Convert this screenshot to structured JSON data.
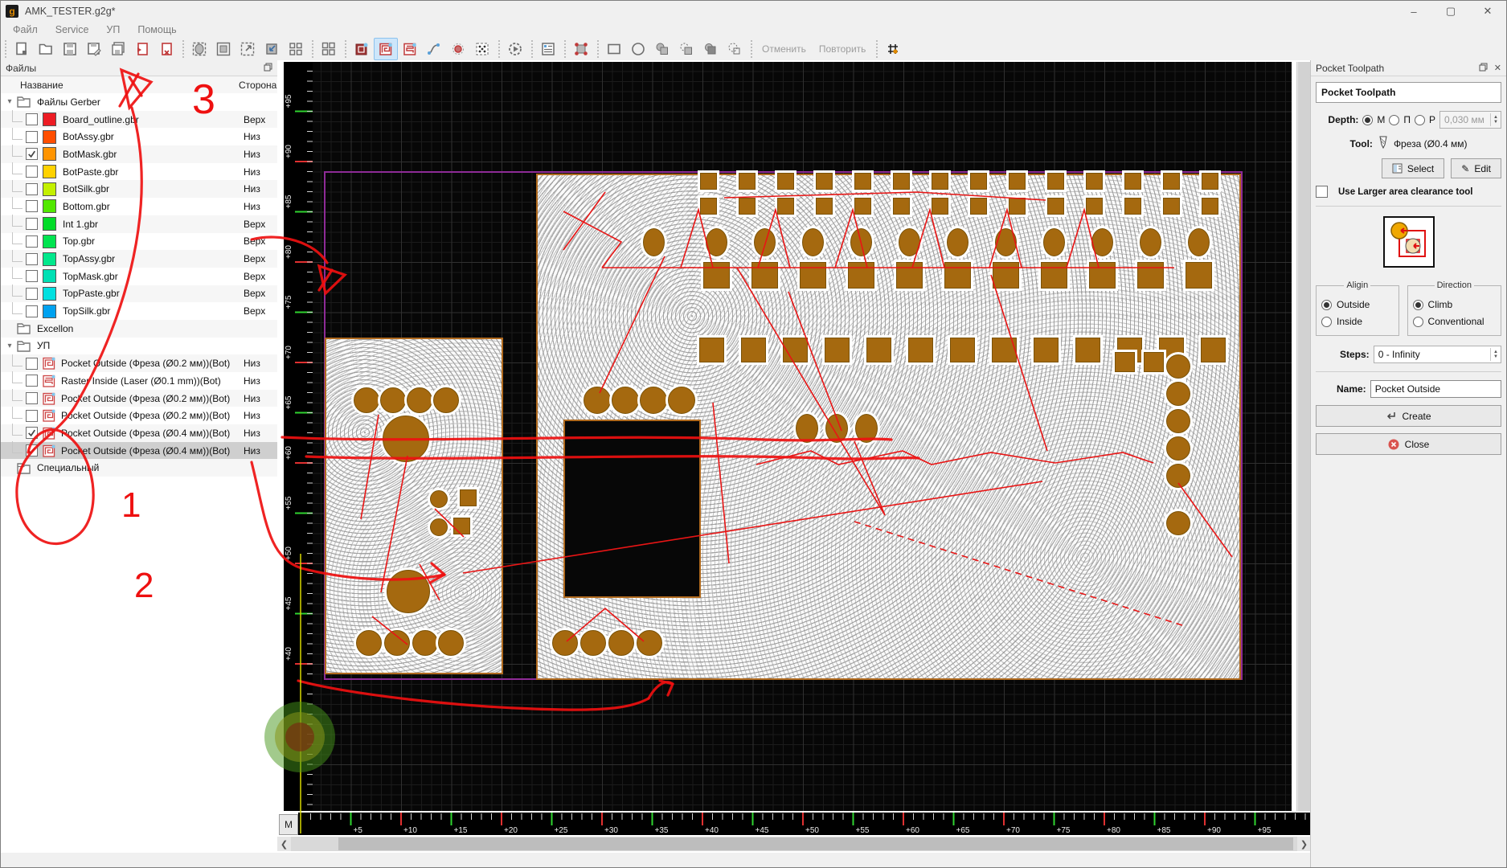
{
  "window": {
    "title": "AMK_TESTER.g2g*"
  },
  "menu": {
    "items": [
      "Файл",
      "Service",
      "УП",
      "Помощь"
    ]
  },
  "toolbar": {
    "undo": "Отменить",
    "redo": "Повторить",
    "groups": [
      [
        {
          "name": "new-file-button",
          "icon": "new"
        },
        {
          "name": "open-button",
          "icon": "open"
        },
        {
          "name": "save-button",
          "icon": "save"
        },
        {
          "name": "save-as-button",
          "icon": "saveAs"
        },
        {
          "name": "save-all-button",
          "icon": "saveAll"
        },
        {
          "name": "import-job-button",
          "icon": "docRedArrow"
        },
        {
          "name": "delete-job-button",
          "icon": "docRedX"
        }
      ],
      [
        {
          "name": "fit-selection-button",
          "icon": "fitSel"
        },
        {
          "name": "fill-view-button",
          "icon": "fillSq"
        },
        {
          "name": "zoom-extents-button",
          "icon": "expand"
        },
        {
          "name": "zoom-selection-button",
          "icon": "shrink"
        },
        {
          "name": "panelize-button",
          "icon": "gridSm"
        }
      ],
      [
        {
          "name": "array-copy-button",
          "icon": "gridBig"
        }
      ],
      [
        {
          "name": "show-board-button",
          "icon": "pocketDoc"
        },
        {
          "name": "show-toolpath-button",
          "icon": "pocketSpiral",
          "active": true
        },
        {
          "name": "show-raster-button",
          "icon": "rasterLines"
        },
        {
          "name": "show-curves-button",
          "icon": "curve"
        },
        {
          "name": "show-drills-button",
          "icon": "circleRed"
        },
        {
          "name": "show-points-button",
          "icon": "dotsSq"
        }
      ],
      [
        {
          "name": "simulate-button",
          "icon": "gearPlay"
        }
      ],
      [
        {
          "name": "properties-button",
          "icon": "form"
        }
      ],
      [
        {
          "name": "transform-button",
          "icon": "transformRed"
        }
      ],
      [
        {
          "name": "draw-rect-button",
          "icon": "rect"
        },
        {
          "name": "draw-circle-button",
          "icon": "circle"
        },
        {
          "name": "bool-union-button",
          "icon": "boolUnion"
        },
        {
          "name": "bool-subtract-button",
          "icon": "boolSub"
        },
        {
          "name": "bool-intersect-button",
          "icon": "boolInt"
        },
        {
          "name": "bool-outline-button",
          "icon": "boolDot"
        }
      ],
      [
        {
          "name": "undo-button",
          "label": "Отменить",
          "disabled": true
        },
        {
          "name": "redo-button",
          "label": "Повторить",
          "disabled": true
        }
      ],
      [
        {
          "name": "snap-grid-button",
          "icon": "snapGrid"
        }
      ]
    ]
  },
  "files_panel": {
    "title": "Файлы",
    "name_col": "Название",
    "side_col": "Сторона",
    "rows": [
      {
        "kind": "folder",
        "label": "Файлы Gerber",
        "expanded": true
      },
      {
        "kind": "gerber",
        "label": "Board_outline.gbr",
        "color": "#ed1c24",
        "side": "Верх",
        "checked": false
      },
      {
        "kind": "gerber",
        "label": "BotAssy.gbr",
        "color": "#ff4e00",
        "side": "Низ",
        "checked": false
      },
      {
        "kind": "gerber",
        "label": "BotMask.gbr",
        "color": "#ff9400",
        "side": "Низ",
        "checked": true
      },
      {
        "kind": "gerber",
        "label": "BotPaste.gbr",
        "color": "#ffd200",
        "side": "Низ",
        "checked": false
      },
      {
        "kind": "gerber",
        "label": "BotSilk.gbr",
        "color": "#c3f000",
        "side": "Низ",
        "checked": false
      },
      {
        "kind": "gerber",
        "label": "Bottom.gbr",
        "color": "#52e800",
        "side": "Низ",
        "checked": false
      },
      {
        "kind": "gerber",
        "label": "Int 1.gbr",
        "color": "#00dc28",
        "side": "Верх",
        "checked": false
      },
      {
        "kind": "gerber",
        "label": "Top.gbr",
        "color": "#00e450",
        "side": "Верх",
        "checked": false
      },
      {
        "kind": "gerber",
        "label": "TopAssy.gbr",
        "color": "#00e88c",
        "side": "Верх",
        "checked": false
      },
      {
        "kind": "gerber",
        "label": "TopMask.gbr",
        "color": "#00e0b4",
        "side": "Верх",
        "checked": false
      },
      {
        "kind": "gerber",
        "label": "TopPaste.gbr",
        "color": "#00e0e0",
        "side": "Верх",
        "checked": false
      },
      {
        "kind": "gerber",
        "label": "TopSilk.gbr",
        "color": "#00a2f0",
        "side": "Верх",
        "checked": false
      },
      {
        "kind": "folder",
        "label": "Excellon",
        "expanded": false
      },
      {
        "kind": "folder",
        "label": "УП",
        "expanded": true
      },
      {
        "kind": "job",
        "icon": "pocket",
        "label": "Pocket Outside (Фреза (Ø0.2 мм))(Bot)",
        "side": "Низ",
        "checked": false
      },
      {
        "kind": "job",
        "icon": "raster",
        "label": "Raster Inside (Laser (Ø0.1 mm))(Bot)",
        "side": "Низ",
        "checked": false
      },
      {
        "kind": "job",
        "icon": "pocket",
        "label": "Pocket Outside (Фреза (Ø0.2 мм))(Bot)",
        "side": "Низ",
        "checked": false
      },
      {
        "kind": "job",
        "icon": "pocket",
        "label": "Pocket Outside (Фреза (Ø0.2 мм))(Bot)",
        "side": "Низ",
        "checked": false
      },
      {
        "kind": "job",
        "icon": "pocket",
        "label": "Pocket Outside (Фреза (Ø0.4 мм))(Bot)",
        "side": "Низ",
        "checked": true
      },
      {
        "kind": "job",
        "icon": "pocket",
        "label": "Pocket Outside (Фреза (Ø0.4 мм))(Bot)",
        "side": "Низ",
        "checked": true,
        "selected": true
      },
      {
        "kind": "folder",
        "label": "Специальный",
        "expanded": false
      }
    ]
  },
  "canvas": {
    "m_button": "M",
    "tick_prefix": "+",
    "h_ticks": [
      5,
      10,
      15,
      20,
      25,
      30,
      35,
      40,
      45,
      50,
      55,
      60,
      65,
      70,
      75,
      80,
      85,
      90,
      95
    ],
    "v_ticks": [
      40,
      45,
      50,
      55,
      60,
      65,
      70,
      75,
      80,
      85,
      90,
      95
    ],
    "colors": {
      "major_red": "#e03030",
      "minor_green": "#2fd32f",
      "copper": "#a5690f",
      "outline_purple": "#8e2b96",
      "region_border": "#b06a1e"
    }
  },
  "right_panel": {
    "header": "Pocket Toolpath",
    "title": "Pocket Toolpath",
    "depth_label": "Depth:",
    "depth_options": [
      "М",
      "П",
      "Р"
    ],
    "depth_selected": "М",
    "depth_value": "0,030 мм",
    "tool_label": "Tool:",
    "tool_value": "Фреза (Ø0.4 мм)",
    "select_label": "Select",
    "edit_label": "Edit",
    "clearance_label": "Use Larger area clearance tool",
    "align_legend": "Aligin",
    "align_options": [
      "Outside",
      "Inside"
    ],
    "align_selected": "Outside",
    "direction_legend": "Direction",
    "direction_options": [
      "Climb",
      "Conventional"
    ],
    "direction_selected": "Climb",
    "steps_label": "Steps:",
    "steps_value": "0 - Infinity",
    "name_label": "Name:",
    "name_value": "Pocket Outside",
    "create_label": "Create",
    "close_label": "Close"
  },
  "annotations": {
    "mark1": "1",
    "mark2": "2",
    "mark3": "3"
  }
}
